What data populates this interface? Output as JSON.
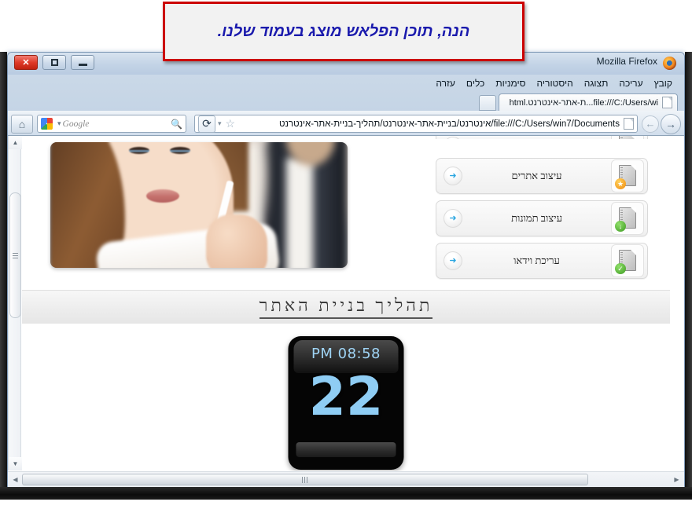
{
  "callout": {
    "text": "הנה, תוכן הפלאש מוצג בעמוד שלנו.",
    "text_color": "#1a1aad",
    "border_color": "#cc0000"
  },
  "window": {
    "title": "Mozilla Firefox",
    "close_glyph": "✕",
    "maximize_glyph": "❐",
    "minimize_glyph": "—"
  },
  "menubar": {
    "items": [
      "קובץ",
      "עריכה",
      "תצוגה",
      "היסטוריה",
      "סימניות",
      "כלים",
      "עזרה"
    ]
  },
  "tabs": [
    {
      "label": "file:///C:/Users/wi...ת-אתר-אינטרנט.html"
    }
  ],
  "toolbar": {
    "url": "file:///C:/Users/win7/Documents/אינטרנט/בניית-אתר-אינטרנט/תהליך-בניית-אתר-אינטרנט",
    "home_glyph": "⌂",
    "reload_glyph": "⟳",
    "star_glyph": "☆",
    "caret_glyph": "▾",
    "back_glyph": "←",
    "forward_glyph": "→"
  },
  "search": {
    "engine": "Google",
    "magnifier_glyph": "🔍",
    "caret_glyph": "▾"
  },
  "scrollbars": {
    "up_glyph": "▲",
    "down_glyph": "▼",
    "left_glyph": "◀",
    "right_glyph": "▶",
    "vertical_position_percent": 42,
    "horizontal_position_percent": 2
  },
  "page": {
    "section_title": "תהליך בניית האתר",
    "go_glyph": "➜",
    "menu_items": [
      {
        "label": "עיצוב אתרים",
        "icon": "document-star-icon"
      },
      {
        "label": "עיצוב תמונות",
        "icon": "document-download-icon"
      },
      {
        "label": "עריכת וידאו",
        "icon": "document-check-icon"
      }
    ],
    "flash_widget": {
      "time": "08:58 PM",
      "day": "22",
      "text_color": "#8fcdf4",
      "background_color": "#050505"
    }
  }
}
